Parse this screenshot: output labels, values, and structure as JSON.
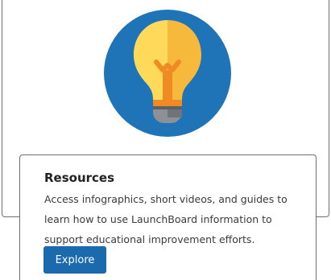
{
  "resources_card": {
    "icon": "lightbulb-icon",
    "title": "Resources",
    "description": "Access infographics, short videos, and guides to learn how to use LaunchBoard information to support educational improvement efforts.",
    "button_label": "Explore"
  },
  "colors": {
    "icon_background": "#1f73b7",
    "bulb_light": "#ffd95a",
    "bulb_dark": "#f6b93b",
    "filament": "#f08a24",
    "button": "#1a6aad"
  }
}
